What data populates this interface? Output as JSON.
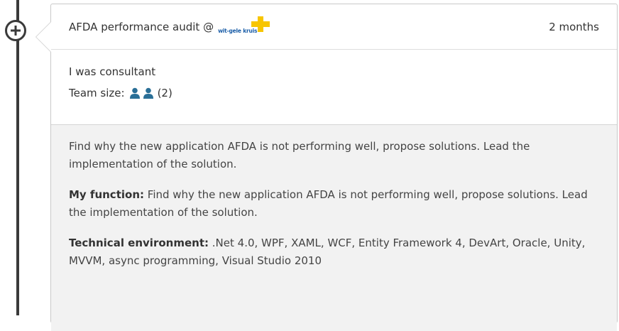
{
  "experience": {
    "title": "AFDA performance audit @",
    "company_logo_text": "wit-gele kruis",
    "duration": "2 months",
    "role": "I was consultant",
    "team_size_label": "Team size:",
    "team_size_count": "(2)",
    "description": "Find why the new application AFDA is not performing well, propose solutions. Lead the implementation of the solution.",
    "function_label": "My function:",
    "function_text": "Find why the new application AFDA is not performing well, propose solutions. Lead the implementation of the solution.",
    "tech_label": "Technical environment:",
    "tech_text": ".Net 4.0, WPF, XAML, WCF, Entity Framework 4, DevArt, Oracle, Unity, MVVM, async programming, Visual Studio 2010"
  },
  "icons": {
    "timeline_node": "plus-circle-icon",
    "team_member": "user-icon",
    "logo_mark": "yellow-cross-icon"
  },
  "colors": {
    "timeline": "#3a3a3a",
    "user_icon": "#2a6f97",
    "logo_text": "#1b5ea8",
    "logo_cross": "#f7c500",
    "body_bg": "#f2f2f2"
  }
}
